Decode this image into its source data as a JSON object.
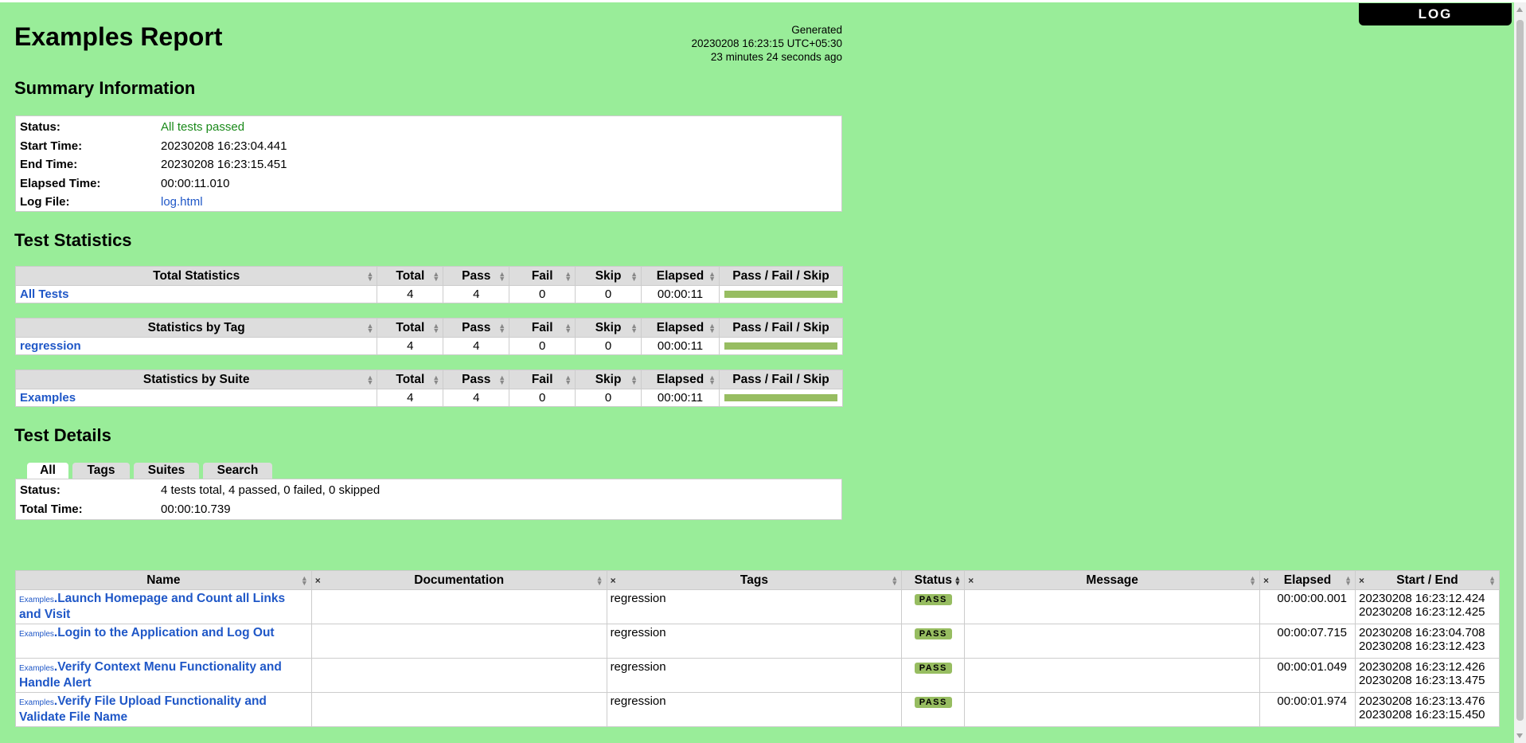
{
  "header": {
    "title": "Examples Report",
    "generated_label": "Generated",
    "generated_time": "20230208 16:23:15 UTC+05:30",
    "generated_ago": "23 minutes 24 seconds ago",
    "log_button": "LOG"
  },
  "summary": {
    "heading": "Summary Information",
    "status_label": "Status:",
    "status_value": "All tests passed",
    "start_label": "Start Time:",
    "start_value": "20230208 16:23:04.441",
    "end_label": "End Time:",
    "end_value": "20230208 16:23:15.451",
    "elapsed_label": "Elapsed Time:",
    "elapsed_value": "00:00:11.010",
    "logfile_label": "Log File:",
    "logfile_value": "log.html"
  },
  "statistics": {
    "heading": "Test Statistics",
    "columns": [
      "Total",
      "Pass",
      "Fail",
      "Skip",
      "Elapsed",
      "Pass / Fail / Skip"
    ],
    "tables": [
      {
        "title": "Total Statistics",
        "row": {
          "name": "All Tests",
          "total": "4",
          "pass": "4",
          "fail": "0",
          "skip": "0",
          "elapsed": "00:00:11",
          "pass_fraction": 1.0
        }
      },
      {
        "title": "Statistics by Tag",
        "row": {
          "name": "regression",
          "total": "4",
          "pass": "4",
          "fail": "0",
          "skip": "0",
          "elapsed": "00:00:11",
          "pass_fraction": 1.0
        }
      },
      {
        "title": "Statistics by Suite",
        "row": {
          "name": "Examples",
          "total": "4",
          "pass": "4",
          "fail": "0",
          "skip": "0",
          "elapsed": "00:00:11",
          "pass_fraction": 1.0
        }
      }
    ]
  },
  "details": {
    "heading": "Test Details",
    "tabs": [
      "All",
      "Tags",
      "Suites",
      "Search"
    ],
    "status_label": "Status:",
    "status_value": "4 tests total, 4 passed, 0 failed, 0 skipped",
    "total_time_label": "Total Time:",
    "total_time_value": "00:00:10.739",
    "columns": [
      "Name",
      "Documentation",
      "Tags",
      "Status",
      "Message",
      "Elapsed",
      "Start / End"
    ],
    "close_glyph": "×",
    "rows": [
      {
        "suite": "Examples",
        "name": "Launch Homepage and Count all Links and Visit",
        "doc": "",
        "tags": "regression",
        "status": "PASS",
        "message": "",
        "elapsed": "00:00:00.001",
        "start": "20230208 16:23:12.424",
        "end": "20230208 16:23:12.425"
      },
      {
        "suite": "Examples",
        "name": "Login to the Application and Log Out",
        "doc": "",
        "tags": "regression",
        "status": "PASS",
        "message": "",
        "elapsed": "00:00:07.715",
        "start": "20230208 16:23:04.708",
        "end": "20230208 16:23:12.423"
      },
      {
        "suite": "Examples",
        "name": "Verify Context Menu Functionality and Handle Alert",
        "doc": "",
        "tags": "regression",
        "status": "PASS",
        "message": "",
        "elapsed": "00:00:01.049",
        "start": "20230208 16:23:12.426",
        "end": "20230208 16:23:13.475"
      },
      {
        "suite": "Examples",
        "name": "Verify File Upload Functionality and Validate File Name",
        "doc": "",
        "tags": "regression",
        "status": "PASS",
        "message": "",
        "elapsed": "00:00:01.974",
        "start": "20230208 16:23:13.476",
        "end": "20230208 16:23:15.450"
      }
    ]
  },
  "colors": {
    "background": "#99ed99",
    "pass_bar": "#97bd61",
    "link": "#1f57c7",
    "status_pass_text": "#1a8a1a"
  }
}
